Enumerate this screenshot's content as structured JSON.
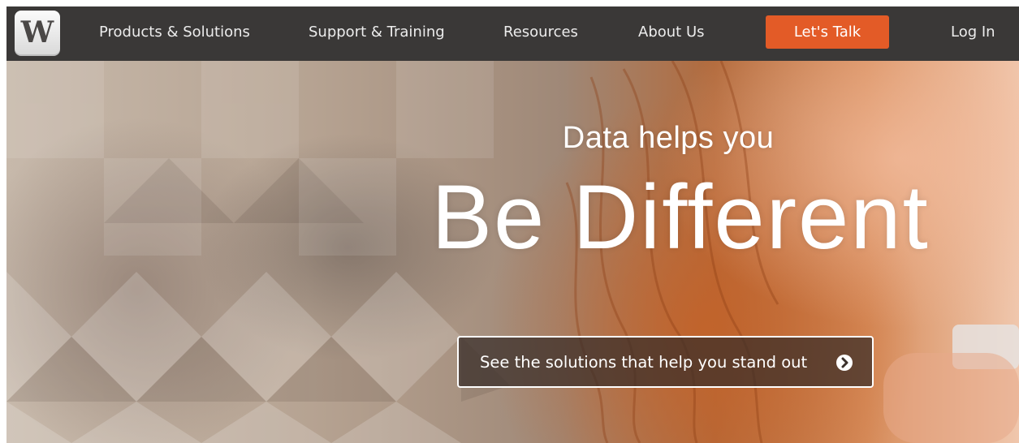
{
  "header": {
    "logo_letter": "W",
    "nav": {
      "products": "Products & Solutions",
      "support": "Support & Training",
      "resources": "Resources",
      "about": "About Us",
      "cta": "Let's Talk",
      "login": "Log In"
    }
  },
  "hero": {
    "kicker": "Data helps you",
    "title": "Be Different",
    "cta_label": "See the solutions that help you stand out",
    "cta_icon": "chevron-right-circle-icon"
  },
  "colors": {
    "nav_background": "#3a3837",
    "accent": "#e35b27",
    "text_light": "#ffffff"
  }
}
